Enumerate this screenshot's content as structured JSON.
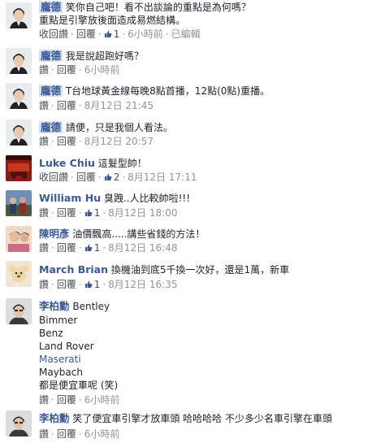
{
  "colors": {
    "name": "#3b5998",
    "meta": "#90949c",
    "highlight": "#d8dfea"
  },
  "comments": [
    {
      "name": "龐德",
      "text": "笑你自己吧！看不出談論的重點是為何嗎？",
      "text2": "重點是引擎放後面造成易燃結構。",
      "actions": [
        "收回讚",
        "回覆"
      ],
      "likes": "1",
      "time": "6小時前",
      "edited": "已編輯"
    },
    {
      "name": "龐德",
      "text": "我是說超跑好嗎？",
      "actions": [
        "讚",
        "回覆"
      ],
      "time": "6小時前"
    },
    {
      "name": "龐德",
      "text": "T台地球黃金線每晚8點首播，12點(0點)重播。",
      "actions": [
        "讚",
        "回覆"
      ],
      "time": "8月12日 21:45"
    },
    {
      "name": "龐德",
      "text": "請便，只是我個人看法。",
      "actions": [
        "讚",
        "回覆"
      ],
      "time": "8月12日 20:57"
    },
    {
      "name": "Luke Chiu",
      "text": "這髮型帥！",
      "actions": [
        "收回讚",
        "回覆"
      ],
      "likes": "2",
      "time": "8月12日 17:11"
    },
    {
      "name": "William Hu",
      "text": "臭跩..人比較帥啦!!!",
      "actions": [
        "讚",
        "回覆"
      ],
      "likes": "1",
      "time": "8月12日 18:00"
    },
    {
      "name": "陳明彥",
      "text": "油價飄高.....講些省錢的方法！",
      "actions": [
        "讚",
        "回覆"
      ],
      "likes": "1",
      "time": "8月12日 16:48"
    },
    {
      "name": "March Brian",
      "text": "換機油到底5千換一次好，還是1萬，新車",
      "actions": [
        "讚",
        "回覆"
      ],
      "likes": "1",
      "time": "8月12日 16:35"
    },
    {
      "name": "李柏勳",
      "text": "Bentley",
      "lines": [
        "Bimmer",
        "Benz",
        "Land Rover",
        "Maserati",
        "Maybach",
        "都是便宜車呢 (笑)"
      ],
      "link_line": "Maserati",
      "actions": [
        "讚",
        "回覆"
      ],
      "time": "6小時前"
    },
    {
      "name": "李柏勳",
      "text": "笑了便宜車引擎才放車頭 哈哈哈哈 不少多少名車引擎在車頭",
      "actions": [
        "讚",
        "回覆"
      ],
      "time": "6小時前"
    }
  ]
}
